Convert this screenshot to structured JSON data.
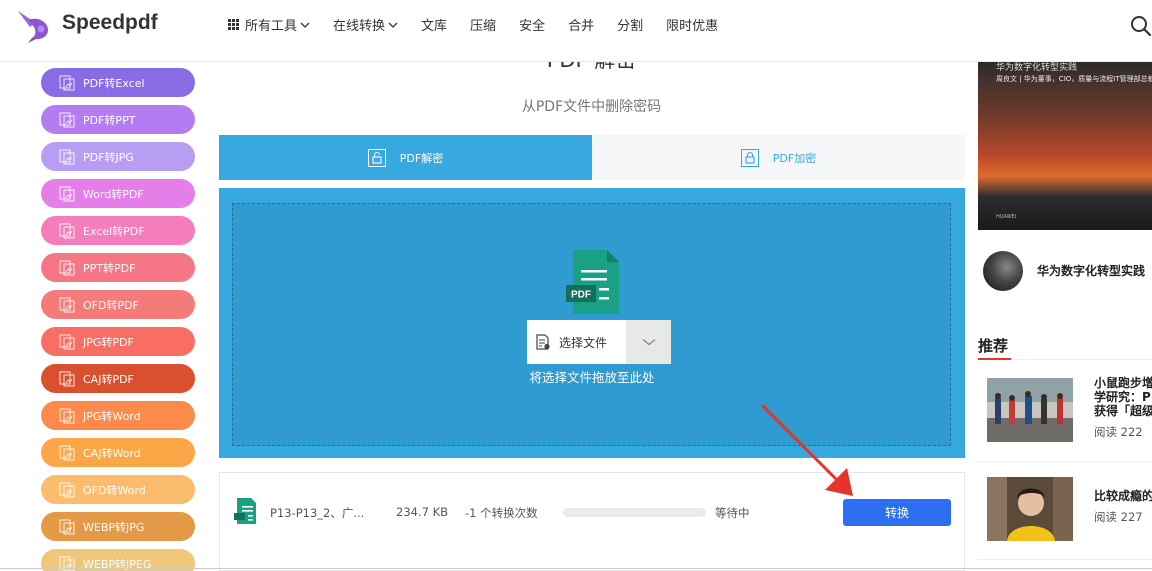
{
  "header": {
    "brand": "Speedpdf",
    "nav": [
      {
        "label": "所有工具",
        "has_dropdown": true,
        "has_grid_icon": true
      },
      {
        "label": "在线转换",
        "has_dropdown": true
      },
      {
        "label": "文库"
      },
      {
        "label": "压缩"
      },
      {
        "label": "安全"
      },
      {
        "label": "合并"
      },
      {
        "label": "分割"
      },
      {
        "label": "限时优惠"
      }
    ],
    "search_icon": "search-icon"
  },
  "sidebar": {
    "items": [
      {
        "label": "PDF转Excel",
        "color": "#8a6be6"
      },
      {
        "label": "PDF转PPT",
        "color": "#b37cf0"
      },
      {
        "label": "PDF转JPG",
        "color": "#b79ef2"
      },
      {
        "label": "Word转PDF",
        "color": "#e57ee8"
      },
      {
        "label": "Excel转PDF",
        "color": "#f47dbb"
      },
      {
        "label": "PPT转PDF",
        "color": "#f57786"
      },
      {
        "label": "OFD转PDF",
        "color": "#f57a7a"
      },
      {
        "label": "JPG转PDF",
        "color": "#f86e65"
      },
      {
        "label": "CAJ转PDF",
        "color": "#d9502f"
      },
      {
        "label": "JPG转Word",
        "color": "#fb8a4b"
      },
      {
        "label": "CAJ转Word",
        "color": "#fba748"
      },
      {
        "label": "OFD转Word",
        "color": "#fbbd6d"
      },
      {
        "label": "WEBP转JPG",
        "color": "#e39945"
      },
      {
        "label": "WEBP转JPEG",
        "color": "#f0c67a"
      }
    ]
  },
  "main": {
    "title": "PDF 解密",
    "subtitle": "从PDF文件中删除密码",
    "tabs": [
      {
        "label": "PDF解密",
        "active": true
      },
      {
        "label": "PDF加密",
        "active": false
      }
    ],
    "upload": {
      "icon_text": "PDF",
      "select_label": "选择文件",
      "drop_hint": "将选择文件拖放至此处"
    },
    "file": {
      "name": "P13-P13_2、广...",
      "size": "234.7 KB",
      "conversions": "-1 个转换次数",
      "progress": 0,
      "status": "等待中",
      "convert_label": "转换"
    },
    "colors": {
      "accent": "#37a8e0",
      "button": "#2d6ef2",
      "arrow": "#e8332b"
    }
  },
  "right": {
    "ad": {
      "title": "华为数字化转型实践",
      "sub": "周良文 | 华为董事，CIO，质量与流程IT管理部总裁",
      "foot": "HUAWEI"
    },
    "author": {
      "name": "华为数字化转型实践"
    },
    "recommend_heading": "推荐",
    "items": [
      {
        "title_lines": [
          "小鼠跑步增",
          "学研究：P",
          "获得「超级"
        ],
        "reads": "阅读 222"
      },
      {
        "title_lines": [
          "比较成瘾的"
        ],
        "reads": "阅读 227"
      }
    ]
  }
}
